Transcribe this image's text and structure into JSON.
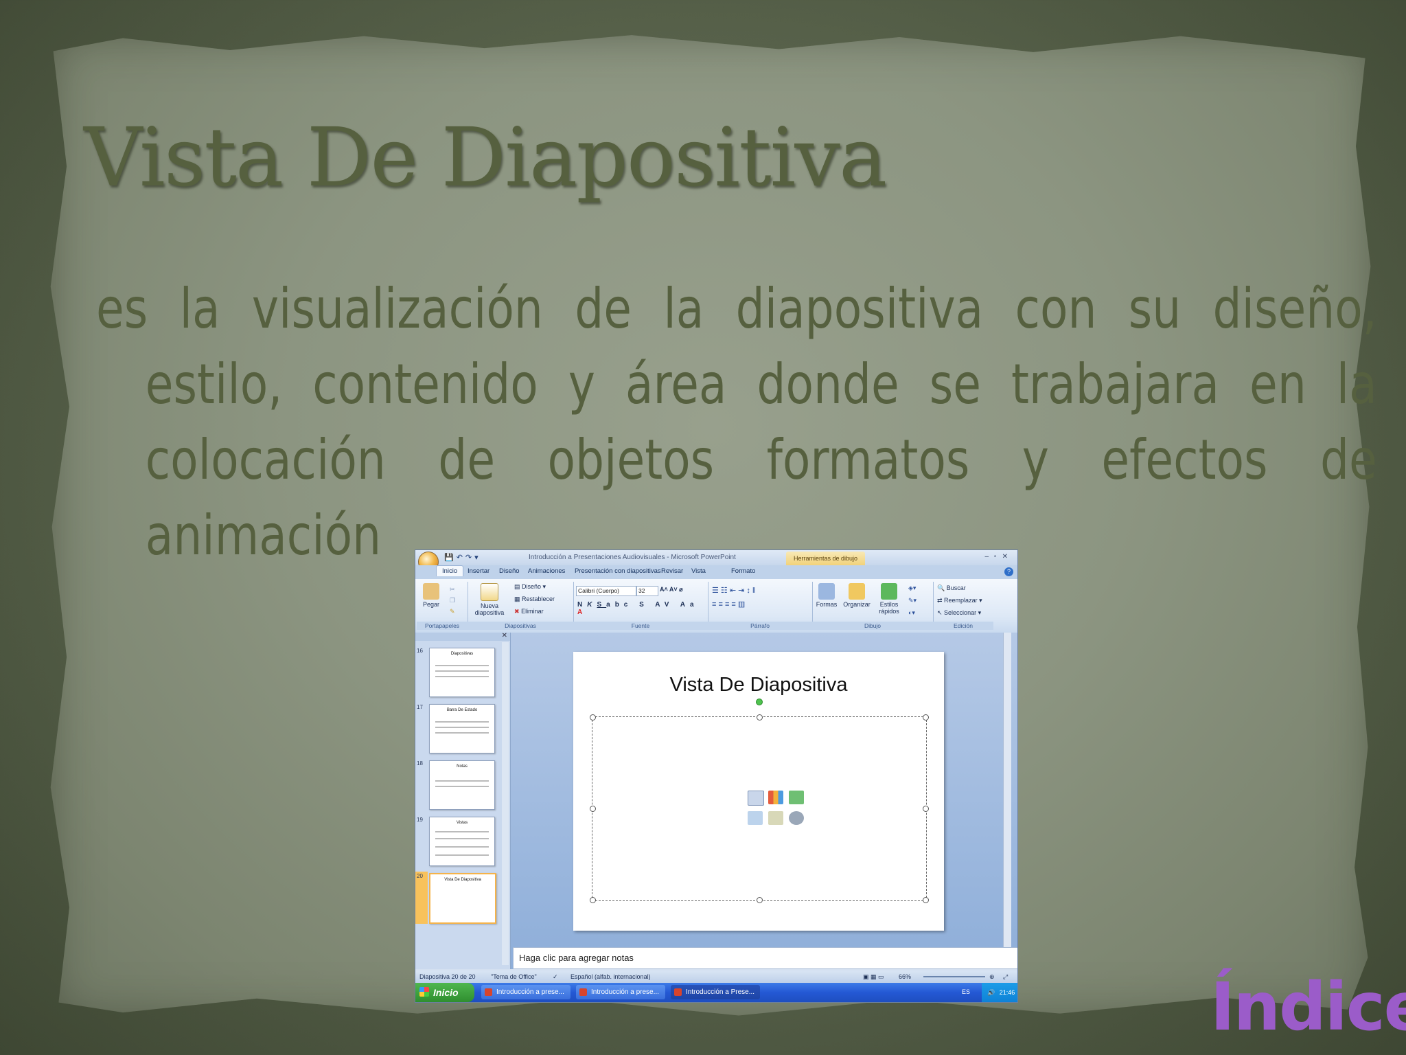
{
  "slide": {
    "title": "Vista De Diapositiva",
    "body": "es la visualización de la diapositiva con su diseño, estilo, contenido y área donde se trabajara en la colocación de objetos formatos y efectos de animación",
    "index_link": "Índice"
  },
  "screenshot": {
    "window_title": "Introducción a Presentaciones Audiovisuales - Microsoft PowerPoint",
    "context_tab": "Herramientas de dibujo",
    "tabs": [
      "Inicio",
      "Insertar",
      "Diseño",
      "Animaciones",
      "Presentación con diapositivas",
      "Revisar",
      "Vista",
      "Formato"
    ],
    "ribbon": {
      "clipboard": {
        "paste": "Pegar",
        "group": "Portapapeles"
      },
      "slides": {
        "new_slide": "Nueva diapositiva",
        "layout": "Diseño",
        "reset": "Restablecer",
        "delete": "Eliminar",
        "group": "Diapositivas"
      },
      "font": {
        "font_name": "Calibri (Cuerpo)",
        "font_size": "32",
        "group": "Fuente"
      },
      "paragraph": {
        "group": "Párrafo"
      },
      "drawing": {
        "shapes": "Formas",
        "arrange": "Organizar",
        "quick_styles": "Estilos rápidos",
        "group": "Dibujo"
      },
      "editing": {
        "find": "Buscar",
        "replace": "Reemplazar",
        "select": "Seleccionar",
        "group": "Edición"
      }
    },
    "thumbnails": [
      {
        "num": "16",
        "title": "Diapositivas"
      },
      {
        "num": "17",
        "title": "Barra De Estado"
      },
      {
        "num": "18",
        "title": "Notas"
      },
      {
        "num": "19",
        "title": "Vistas"
      },
      {
        "num": "20",
        "title": "Vista De Diapositiva"
      }
    ],
    "current_slide_title": "Vista De Diapositiva",
    "notes_placeholder": "Haga clic para agregar notas",
    "status": {
      "slide_count": "Diapositiva 20 de 20",
      "theme": "\"Tema de Office\"",
      "language": "Español (alfab. internacional)",
      "zoom": "66%"
    },
    "taskbar": {
      "start": "Inicio",
      "items": [
        "Introducción a prese...",
        "Introducción a prese...",
        "Introducción a Prese..."
      ],
      "lang": "ES",
      "clock": "21:46"
    }
  }
}
